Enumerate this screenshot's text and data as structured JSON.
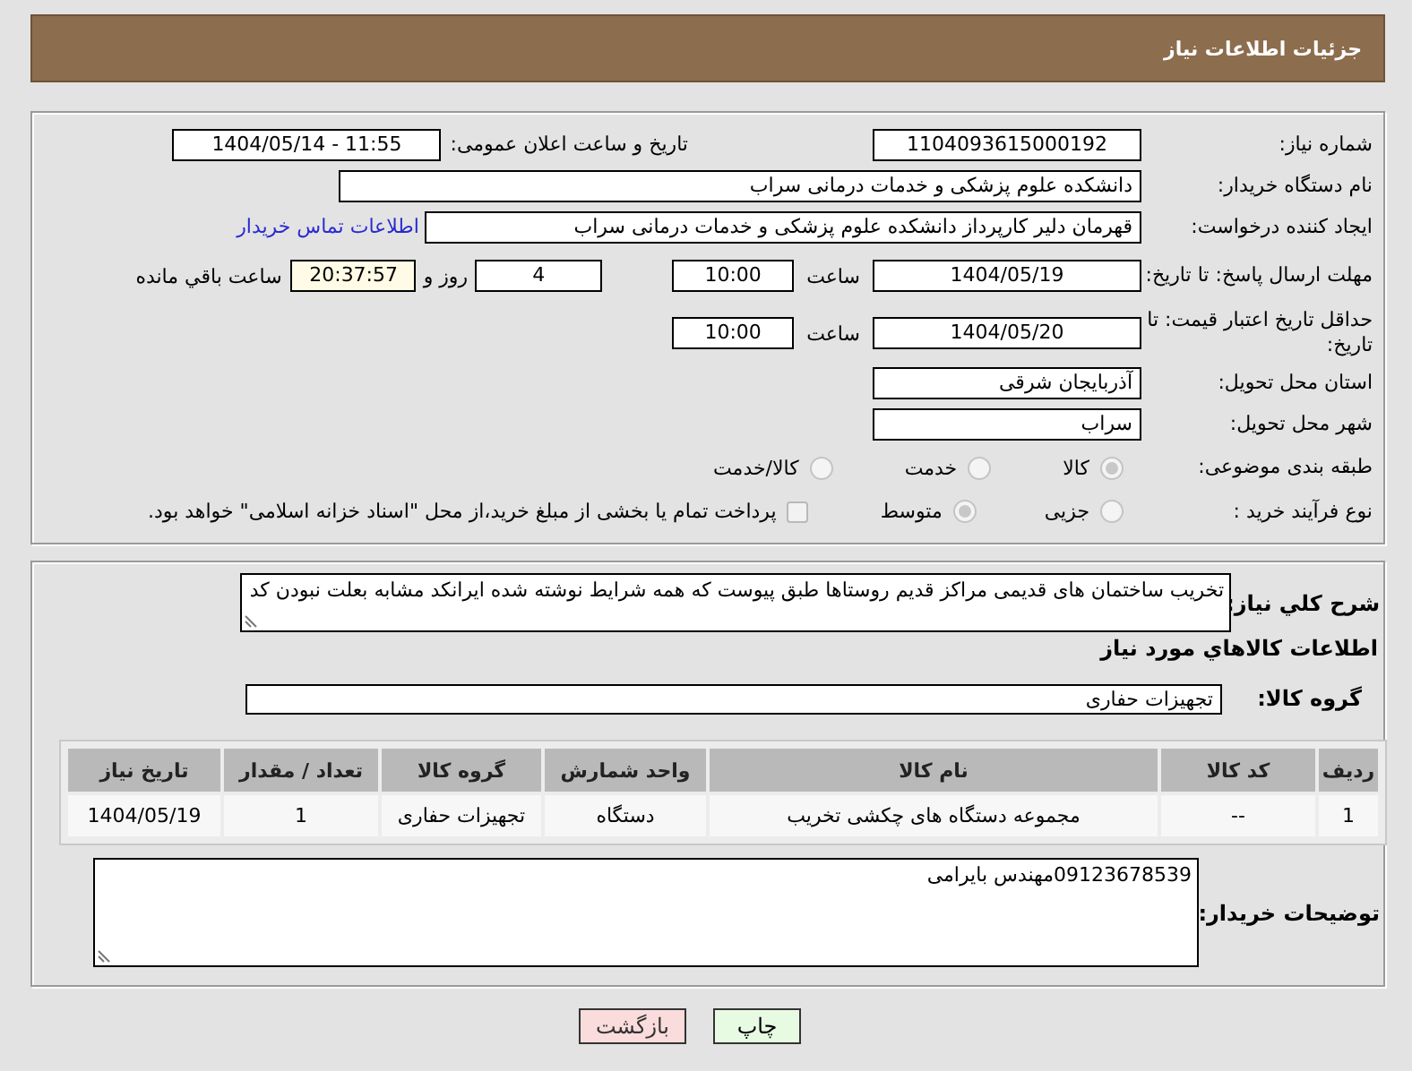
{
  "header": {
    "title": "جزئیات اطلاعات نیاز"
  },
  "need_number": {
    "label": "شماره نیاز:",
    "value": "1104093615000192"
  },
  "announce": {
    "label": "تاریخ و ساعت اعلان عمومی:",
    "value": "1404/05/14 - 11:55"
  },
  "buyer_org": {
    "label": "نام دستگاه خریدار:",
    "value": "دانشکده علوم پزشکی و خدمات درمانی سراب"
  },
  "requester": {
    "label": "ایجاد کننده درخواست:",
    "value": "قهرمان دلیر کارپرداز دانشکده علوم پزشکی و خدمات درمانی سراب",
    "link": "اطلاعات تماس خریدار"
  },
  "reply_deadline": {
    "label": "مهلت ارسال پاسخ: تا تاریخ:",
    "date": "1404/05/19",
    "time_label": "ساعت",
    "time": "10:00",
    "days": "4",
    "days_label": "روز و",
    "remaining": "20:37:57",
    "remaining_label": "ساعت باقي مانده"
  },
  "price_validity": {
    "label": "حداقل تاریخ اعتبار قیمت: تا تاریخ:",
    "date": "1404/05/20",
    "time_label": "ساعت",
    "time": "10:00"
  },
  "province": {
    "label": "استان محل تحویل:",
    "value": "آذربایجان شرقی"
  },
  "city": {
    "label": "شهر محل تحویل:",
    "value": "سراب"
  },
  "category": {
    "label": "طبقه بندی موضوعی:",
    "options": [
      {
        "label": "کالا",
        "selected": true
      },
      {
        "label": "خدمت",
        "selected": false
      },
      {
        "label": "کالا/خدمت",
        "selected": false
      }
    ]
  },
  "process": {
    "label": "نوع فرآیند خرید :",
    "options": [
      {
        "label": "جزیی",
        "selected": false
      },
      {
        "label": "متوسط",
        "selected": true
      }
    ],
    "treasury": {
      "label": "پرداخت تمام یا بخشی از مبلغ خرید،از محل \"اسناد خزانه اسلامی\" خواهد بود.",
      "checked": false
    }
  },
  "description": {
    "label": "شرح کلي نياز:",
    "value": "تخریب ساختمان های قدیمی مراکز قدیم روستاها طبق پیوست که همه شرایط نوشته شده ایرانکد مشابه بعلت نبودن کد"
  },
  "goods": {
    "heading": "اطلاعات کالاهاي مورد نياز",
    "group_label": "گروه کالا:",
    "group_value": "تجهیزات حفاری",
    "table": {
      "columns": [
        "ردیف",
        "کد کالا",
        "نام کالا",
        "واحد شمارش",
        "گروه کالا",
        "تعداد / مقدار",
        "تاریخ نیاز"
      ],
      "rows": [
        [
          "1",
          "--",
          "مجموعه دستگاه های چکشی تخریب",
          "دستگاه",
          "تجهیزات حفاری",
          "1",
          "1404/05/19"
        ]
      ]
    }
  },
  "buyer_notes": {
    "label": "توضیحات خریدار:",
    "value": "09123678539مهندس بایرامی"
  },
  "buttons": [
    {
      "label": "چاپ",
      "kind": "print"
    },
    {
      "label": "بازگشت",
      "kind": "back"
    }
  ]
}
